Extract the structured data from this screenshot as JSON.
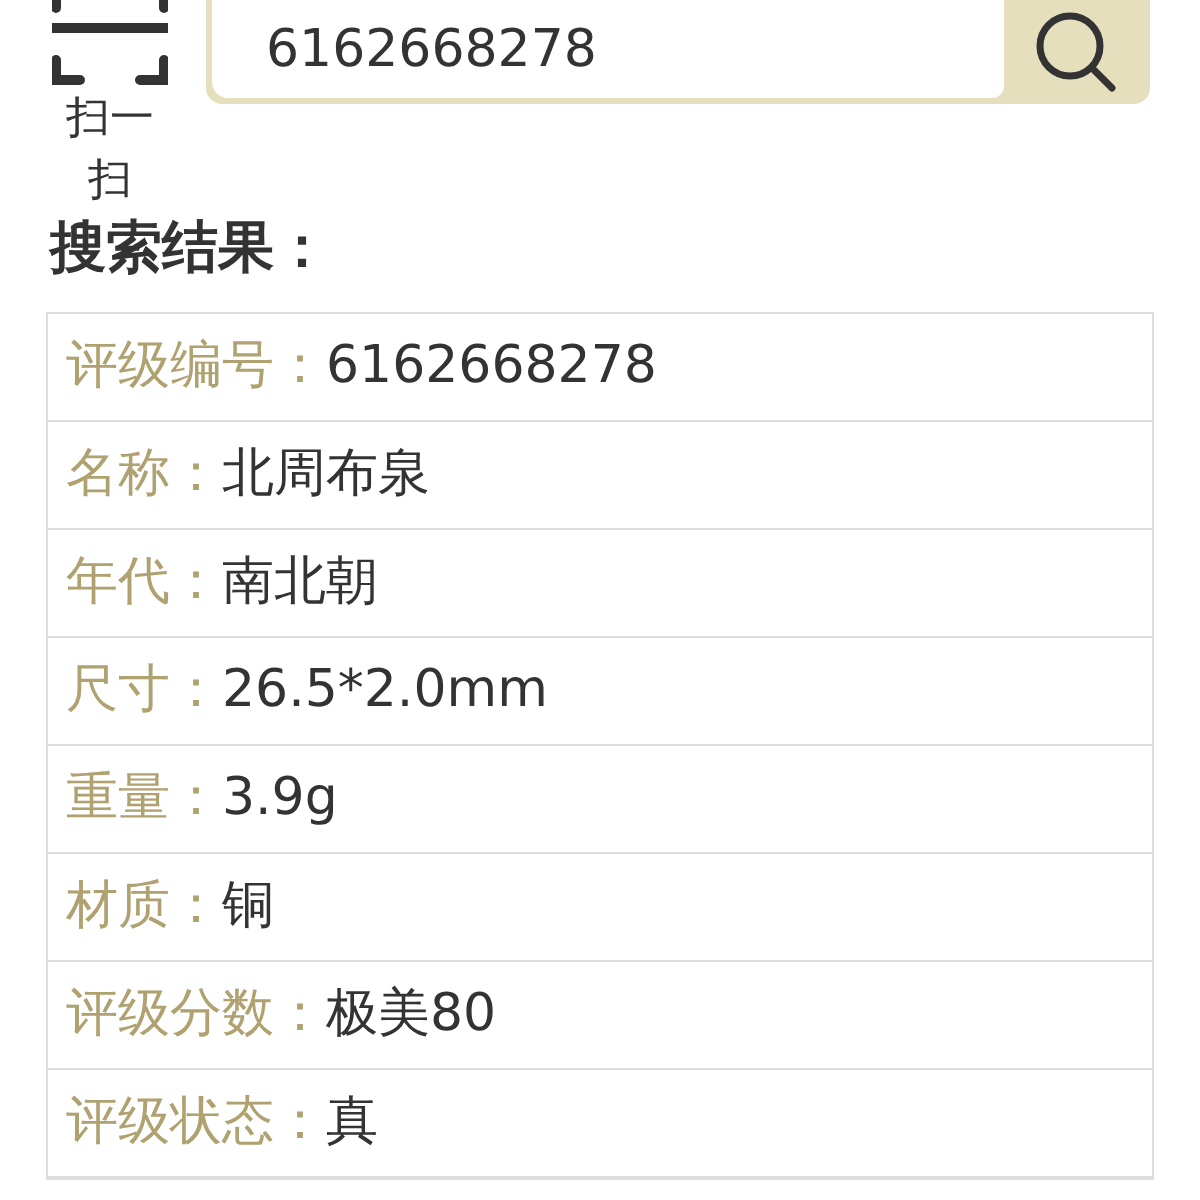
{
  "scan": {
    "label": "扫一扫"
  },
  "search": {
    "value": "6162668278"
  },
  "results_title": "搜索结果：",
  "rows": [
    {
      "label": "评级编号：",
      "value": "6162668278"
    },
    {
      "label": "名称：",
      "value": "北周布泉"
    },
    {
      "label": "年代：",
      "value": "南北朝"
    },
    {
      "label": "尺寸：",
      "value": "26.5*2.0mm"
    },
    {
      "label": "重量：",
      "value": "3.9g"
    },
    {
      "label": "材质：",
      "value": "铜"
    },
    {
      "label": "评级分数：",
      "value": "极美80"
    },
    {
      "label": "评级状态：",
      "value": "真"
    }
  ]
}
